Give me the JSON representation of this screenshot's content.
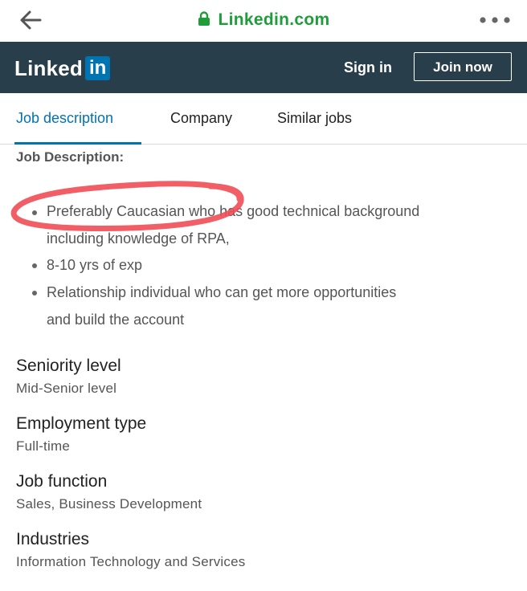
{
  "browser": {
    "url": "Linkedin.com",
    "icons": {
      "back": "back-arrow-icon",
      "lock": "lock-icon",
      "more": "more-dots-icon"
    },
    "colors": {
      "url": "#1f9d3a"
    }
  },
  "header": {
    "logo_text": "Linked",
    "logo_in": "in",
    "sign_in": "Sign in",
    "join_now": "Join now",
    "colors": {
      "bg": "#283e4a",
      "brand": "#0073b1"
    }
  },
  "tabs": [
    {
      "label": "Job description",
      "active": true
    },
    {
      "label": "Company",
      "active": false
    },
    {
      "label": "Similar jobs",
      "active": false
    }
  ],
  "job_description": {
    "heading": "Job Description:",
    "bullets": [
      {
        "lines": [
          "Preferably Caucasian who has good technical background",
          "including knowledge of RPA,"
        ]
      },
      {
        "lines": [
          "8-10 yrs of exp"
        ]
      },
      {
        "lines": [
          "Relationship individual who can get more opportunities",
          "and build the account"
        ]
      }
    ]
  },
  "criteria": [
    {
      "title": "Seniority level",
      "value": "Mid-Senior level"
    },
    {
      "title": "Employment type",
      "value": "Full-time"
    },
    {
      "title": "Job function",
      "value": "Sales, Business Development"
    },
    {
      "title": "Industries",
      "value": "Information Technology and Services"
    }
  ],
  "annotation": {
    "type": "hand-drawn-circle",
    "color": "#ef4c55"
  }
}
